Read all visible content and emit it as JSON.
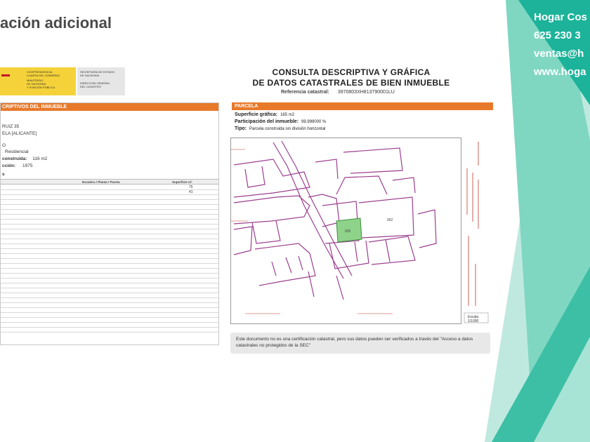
{
  "slide": {
    "title": "ación adicional"
  },
  "agency": {
    "name": "Hogar Cos",
    "phone": "625 230 3",
    "email": "ventas@h",
    "web": "www.hoga"
  },
  "left": {
    "gov_lines": [
      "VICEPRESIDENCIA",
      "CUARTA DEL GOBIERNO",
      "MINISTERIO",
      "DE HACIENDA",
      "Y FUNCIÓN PÚBLICA"
    ],
    "gov_right_lines": [
      "SECRETARÍA DE ESTADO",
      "DE HACIENDA",
      "DIRECCIÓN GENERAL",
      "DEL CATASTRO"
    ],
    "section_title": "CRIPTIVOS DEL INMUEBLE",
    "address_1": "RUIZ 35",
    "address_2": "ELA [ALICANTE]",
    "use_label": "O",
    "use_value": "Residencial",
    "built_label": "construida:",
    "built_value": "116 m2",
    "year_label": "cción:",
    "year_value": "1975",
    "table_caption": "s",
    "col_escalera": "Escalera / Planta / Puerta",
    "col_superficie": "Superficie m²",
    "values": [
      "75",
      "41"
    ]
  },
  "doc": {
    "title_1": "CONSULTA DESCRIPTIVA Y GRÁFICA",
    "title_2": "DE DATOS CATASTRALES DE BIEN INMUEBLE",
    "ref_label": "Referencia catastral:",
    "ref_value": "3970803XH813790001LU",
    "parcela_title": "PARCELA",
    "surface_label": "Superficie gráfica:",
    "surface_value": "165 m2",
    "participation_label": "Participación del inmueble:",
    "participation_value": "99,999000 %",
    "type_label": "Tipo:",
    "type_value": "Parcela construida sin división horizontal",
    "scale_label": "Escala",
    "scale_value": "1/1000",
    "disclaimer": "Este documento no es una certificación catastral, pero sus datos pueden ser verificados a través del \"Acceso a datos catastrales no protegidos de la SEC\"",
    "map_parcel_label": "035",
    "map_label_b": "062"
  },
  "colors": {
    "orange": "#e8792b",
    "teal": "#3dbfa5",
    "map_line": "#9b3f8f",
    "parcel_fill": "#8fd38a",
    "gov_yellow": "#f5d23a"
  }
}
